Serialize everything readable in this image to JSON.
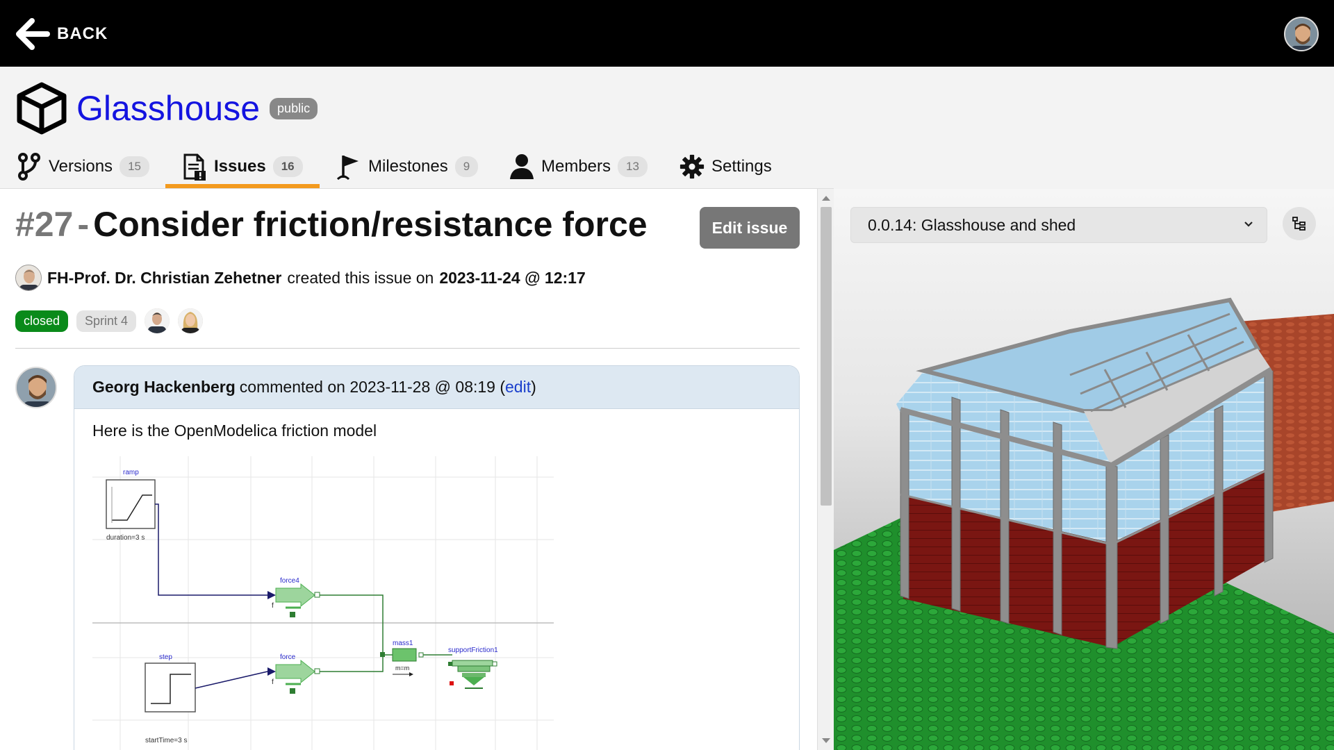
{
  "topbar": {
    "back_label": "BACK"
  },
  "project": {
    "title": "Glasshouse",
    "visibility": "public"
  },
  "tabs": [
    {
      "label": "Versions",
      "count": "15",
      "icon": "branch-icon"
    },
    {
      "label": "Issues",
      "count": "16",
      "icon": "issue-icon",
      "active": true
    },
    {
      "label": "Milestones",
      "count": "9",
      "icon": "milestone-flag-icon"
    },
    {
      "label": "Members",
      "count": "13",
      "icon": "person-icon"
    },
    {
      "label": "Settings",
      "icon": "gear-icon"
    }
  ],
  "issue": {
    "number": "#27",
    "title": "Consider friction/resistance force",
    "edit_label": "Edit issue",
    "author": "FH-Prof. Dr. Christian Zehetner",
    "created_text": "created this issue on",
    "created_at": "2023-11-24 @ 12:17",
    "status": "closed",
    "milestone": "Sprint 4"
  },
  "comment": {
    "author": "Georg Hackenberg",
    "commented_text": "commented on 2023-11-28 @ 08:19 (",
    "edit_label": "edit",
    "close_paren": ")",
    "body": "Here is the OpenModelica friction model"
  },
  "diagram": {
    "ramp_name": "ramp",
    "ramp_param": "duration=3 s",
    "force4_name": "force4",
    "force_name": "force",
    "mass_name": "mass1",
    "mass_param": "m=m",
    "support_name": "supportFriction1",
    "step_name": "step",
    "step_param": "startTime=3 s",
    "f_label": "f"
  },
  "viewer": {
    "selected_version": "0.0.14: Glasshouse and shed"
  },
  "colors": {
    "accent": "#f39a1e",
    "link": "#1414e0",
    "closed": "#0a8a1a"
  }
}
